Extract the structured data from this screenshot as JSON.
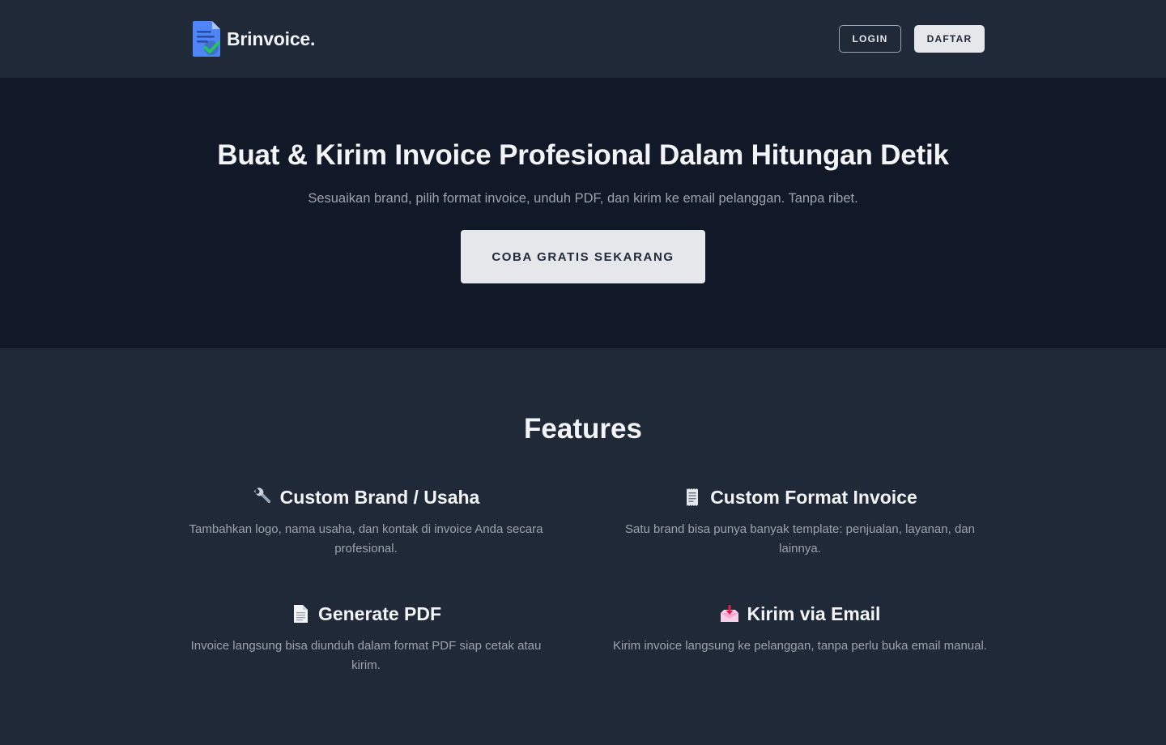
{
  "header": {
    "brand": "Brinvoice.",
    "login_label": "LOGIN",
    "register_label": "DAFTAR"
  },
  "hero": {
    "title": "Buat & Kirim Invoice Profesional Dalam Hitungan Detik",
    "subtitle": "Sesuaikan brand, pilih format invoice, unduh PDF, dan kirim ke email pelanggan. Tanpa ribet.",
    "cta_label": "COBA GRATIS SEKARANG"
  },
  "features": {
    "title": "Features",
    "items": [
      {
        "icon": "wrench-icon",
        "title": "Custom Brand / Usaha",
        "description": "Tambahkan logo, nama usaha, dan kontak di invoice Anda secara profesional."
      },
      {
        "icon": "receipt-icon",
        "title": "Custom Format Invoice",
        "description": "Satu brand bisa punya banyak template: penjualan, layanan, dan lainnya."
      },
      {
        "icon": "document-icon",
        "title": "Generate PDF",
        "description": "Invoice langsung bisa diunduh dalam format PDF siap cetak atau kirim."
      },
      {
        "icon": "inbox-tray-icon",
        "title": "Kirim via Email",
        "description": "Kirim invoice langsung ke pelanggan, tanpa perlu buka email manual."
      }
    ]
  },
  "colors": {
    "header_bg": "#1f2937",
    "hero_bg": "#111827",
    "features_bg": "#1f2937",
    "text_primary": "#f3f4f6",
    "text_muted": "#9ca3af",
    "button_light": "#e5e7eb",
    "logo_blue": "#4f86f7",
    "logo_check": "#22c55e"
  }
}
